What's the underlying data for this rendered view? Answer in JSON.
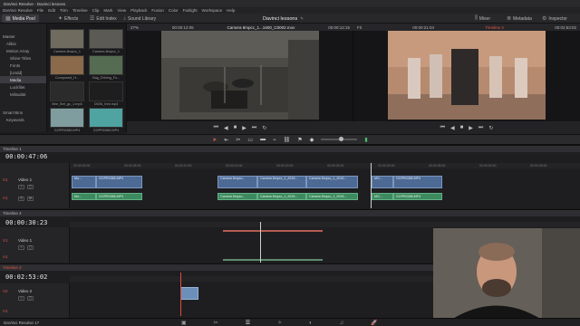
{
  "window": {
    "title": "DaVinci Resolve - Davinci lessons"
  },
  "menu": [
    "DaVinci Resolve",
    "File",
    "Edit",
    "Trim",
    "Timeline",
    "Clip",
    "Mark",
    "View",
    "Playback",
    "Fusion",
    "Color",
    "Fairlight",
    "Workspace",
    "Help"
  ],
  "toolbar": {
    "media_pool": "Media Pool",
    "effects": "Effects",
    "edit_index": "Edit Index",
    "sound_library": "Sound Library",
    "project_name": "Davinci lessons",
    "mixer": "Mixer",
    "metadata": "Metadata",
    "inspector": "Inspector"
  },
  "bin_list": {
    "items": [
      "Master",
      "Alibis",
      "Motion Array",
      "Shine Titles",
      "Fonts",
      "[Undd]",
      "Media",
      "Luckfilet",
      "Milisubtit"
    ],
    "smart_bins": "Smart Bins",
    "keywords": "Keywords"
  },
  "media_pool": {
    "clips": [
      {
        "label": "Camera 8mpcc_1",
        "color": "#6f6b5f"
      },
      {
        "label": "Camera 8mpcc_1",
        "color": "#5b5a55"
      },
      {
        "label": "Composed_H...",
        "color": "#8a6a4a"
      },
      {
        "label": "Gag_Driving_Fo...",
        "color": "#556b52"
      },
      {
        "label": "Bee_Bet_gc_1.mp3",
        "color": "#2b2b2b"
      },
      {
        "label": "DGNI_thm.mp3",
        "color": "#1e1e1e"
      },
      {
        "label": "GOPR0385.MP4",
        "color": "#7f9c9f"
      },
      {
        "label": "GOPR0385.MP4",
        "color": "#4fa3a1"
      }
    ]
  },
  "source_viewer": {
    "zoom": "27%",
    "timecode_left": "00:00:12:05",
    "clip_name": "Camera 8mpcc_1...1600_C0002.mov",
    "timecode_right": "00:00:12:15"
  },
  "record_viewer": {
    "zoom": "Fit",
    "timecode_left": "00:00:21:04",
    "timeline_name": "Timeline 2",
    "timecode_right": "00:02:53:02"
  },
  "timelines": [
    {
      "name": "Timeline 1",
      "timecode": "00:00:47:06",
      "video_track": "Video 1",
      "v_label": "V1",
      "a_label": "A1",
      "ruler_ticks": [
        "00:00:00:00",
        "00:00:05:00",
        "00:00:10:00",
        "00:00:15:00",
        "00:00:20:00",
        "00:00:25:00",
        "00:00:30:00",
        "00:00:35:00",
        "00:00:40:00",
        "00:00:45:00"
      ],
      "video_clips": [
        "Mo...",
        "GOPR0385.MP4",
        "Camera 8mpcc...",
        "Camera 8mpcc_1_2019...",
        "Camera 8mpcc_1_2019...",
        "MO...",
        "GOPR0385.MP4"
      ],
      "audio_clips": [
        "Mo...",
        "GOPR0385.MP4",
        "Camera 8mpcc...",
        "Camera 8mpcc_1_2019...",
        "Camera 8mpcc_1_2019...",
        "MO...",
        "GOPR0385.MP4"
      ]
    },
    {
      "name": "Timeline 4",
      "timecode": "00:00:30:23",
      "video_track": "Video 1",
      "v_label": "V1",
      "a_label": "A1"
    },
    {
      "name": "Timeline 2",
      "timecode": "00:02:53:02",
      "video_track": "Video 2",
      "v_label": "V2",
      "a_label": "V1"
    }
  ],
  "bottom": {
    "app_label": "DaVinci Resolve 17"
  },
  "colors": {
    "accent_red": "#e04b3b",
    "video_clip": "#4d6a94",
    "audio_clip": "#3e8a5f",
    "panel_bg": "#1e1e21"
  }
}
